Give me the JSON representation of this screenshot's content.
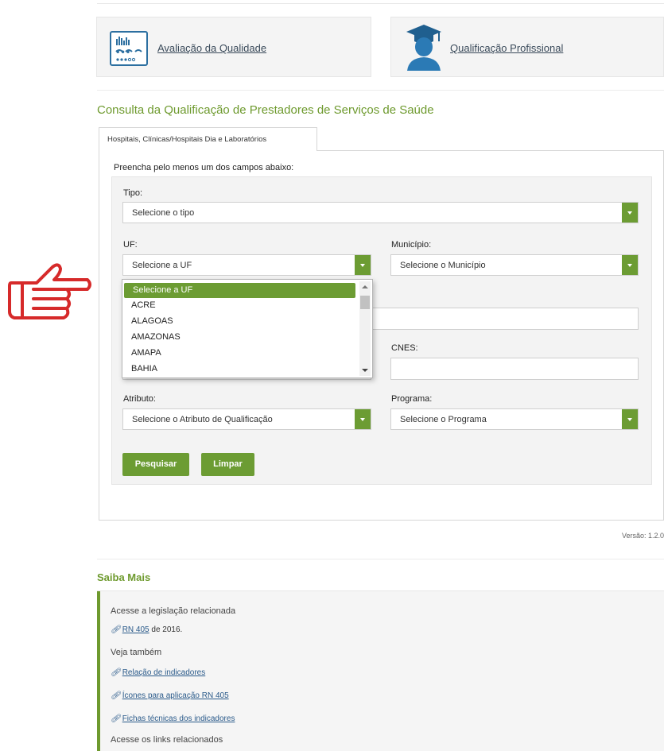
{
  "cards": [
    {
      "label": "Avaliação da Qualidade",
      "icon": "chart-document-icon"
    },
    {
      "label": "Qualificação Profissional",
      "icon": "graduate-user-icon"
    }
  ],
  "section_title": "Consulta da Qualificação de Prestadores de Serviços de Saúde",
  "tab_label": "Hospitais, Clínicas/Hospitais Dia e Laboratórios",
  "form": {
    "instruction": "Preencha pelo menos um dos campos abaixo:",
    "tipo_label": "Tipo:",
    "tipo_value": "Selecione o tipo",
    "uf_label": "UF:",
    "uf_value": "Selecione a UF",
    "municipio_label": "Município:",
    "municipio_value": "Selecione o Município",
    "cnes_label": "CNES:",
    "atributo_label": "Atributo:",
    "atributo_value": "Selecione o Atributo de Qualificação",
    "programa_label": "Programa:",
    "programa_value": "Selecione o Programa",
    "search_button": "Pesquisar",
    "clear_button": "Limpar"
  },
  "uf_options": [
    "Selecione a UF",
    "ACRE",
    "ALAGOAS",
    "AMAZONAS",
    "AMAPA",
    "BAHIA"
  ],
  "version": "Versão: 1.2.0",
  "saiba_mais": {
    "title": "Saiba Mais",
    "legislation_heading": "Acesse a legislação relacionada",
    "rn_link": "RN 405",
    "rn_suffix": " de 2016.",
    "see_also": "Veja também",
    "links": [
      "Relação de indicadores",
      "Ícones para aplicação RN 405",
      "Fichas técnicas dos indicadores"
    ],
    "related_links_heading": "Acesse os links relacionados"
  },
  "colors": {
    "accent_green": "#6c9c33",
    "title_green": "#6e9a2e",
    "pointer_red": "#d62a2a"
  }
}
